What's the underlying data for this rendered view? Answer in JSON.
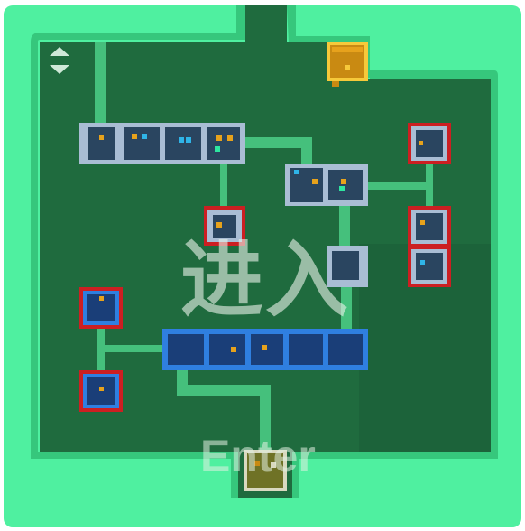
{
  "overlay": {
    "title_cn": "进入",
    "title_en": "Enter"
  },
  "controls": {
    "scroll_icons": [
      "chevron-up-icon",
      "chevron-down-icon"
    ]
  },
  "colors": {
    "background": "#1f6b3e",
    "wall": "#4ff0a0",
    "wall_dark": "#36c77c",
    "path": "#45c07c",
    "room_gray": "#a9bdd4",
    "room_dark": "#2a4560",
    "room_blue": "#2f7fe0",
    "room_blue_dark": "#1a3e78",
    "locked_border": "#cc1f22",
    "treasure": "#e7a21c",
    "entrance": "#7a7a2a"
  },
  "map": {
    "rooms": [
      {
        "id": "gray-row-1",
        "kind": "gray",
        "cells": 4,
        "locked": false
      },
      {
        "id": "gray-pair",
        "kind": "gray",
        "cells": 2,
        "locked": false
      },
      {
        "id": "gray-center-locked",
        "kind": "gray",
        "cells": 1,
        "locked": true
      },
      {
        "id": "gray-square",
        "kind": "gray",
        "cells": 1,
        "locked": false
      },
      {
        "id": "gray-right-top-locked",
        "kind": "gray",
        "cells": 1,
        "locked": true
      },
      {
        "id": "gray-right-mid-locked",
        "kind": "gray",
        "cells": 1,
        "locked": true
      },
      {
        "id": "gray-right-low-locked",
        "kind": "gray",
        "cells": 1,
        "locked": true
      },
      {
        "id": "blue-row",
        "kind": "blue",
        "cells": 5,
        "locked": false
      },
      {
        "id": "blue-left-top-locked",
        "kind": "blue",
        "cells": 1,
        "locked": true
      },
      {
        "id": "blue-left-bottom-locked",
        "kind": "blue",
        "cells": 1,
        "locked": true
      },
      {
        "id": "treasure-room",
        "kind": "gold",
        "cells": 1,
        "locked": false
      },
      {
        "id": "entrance-room",
        "kind": "olive",
        "cells": 1,
        "locked": false
      }
    ]
  }
}
